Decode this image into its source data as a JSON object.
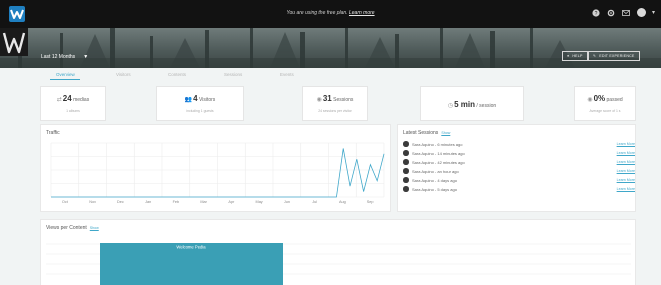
{
  "topbar": {
    "notice_text": "You are using the free plan.",
    "notice_link": "Learn more",
    "icons": [
      "help-icon",
      "settings-icon",
      "mail-icon",
      "user-avatar",
      "chevron-down-icon"
    ]
  },
  "hero": {
    "period": "Last 12 Months",
    "help_label": "HELP",
    "edit_label": "EDIT EXPERIENCE"
  },
  "tabs": [
    {
      "label": "Overview",
      "active": true
    },
    {
      "label": "Visitors"
    },
    {
      "label": "Contents"
    },
    {
      "label": "Sessions"
    },
    {
      "label": "Events"
    }
  ],
  "stats": [
    {
      "icon": "share-icon",
      "value": "24",
      "unit": "medias",
      "sub": "1 albums"
    },
    {
      "icon": "visitors-icon",
      "value": "4",
      "unit": "Visitors",
      "sub": "including 1 guests"
    },
    {
      "icon": "eye-icon",
      "value": "31",
      "unit": "Sessions",
      "sub": "24 sessions per visitor"
    },
    {
      "icon": "clock-icon",
      "value": "5 min",
      "unit": "/ session",
      "sub": ""
    },
    {
      "icon": "percent-icon",
      "value": "0%",
      "unit": "passed",
      "sub": "Average score of 1 s"
    }
  ],
  "traffic": {
    "title": "Traffic"
  },
  "chart_data": {
    "type": "line",
    "title": "Traffic",
    "categories": [
      "Oct",
      "Nov",
      "Dec",
      "Jan",
      "Feb",
      "Mar",
      "Apr",
      "May",
      "Jun",
      "Jul",
      "Aug",
      "Sep"
    ],
    "series": [
      {
        "values": [
          0,
          0,
          0,
          0,
          0,
          0,
          0,
          0,
          0,
          0,
          0,
          0,
          0,
          0,
          0,
          0,
          0,
          0,
          0,
          0,
          0,
          0,
          0,
          0,
          0,
          0,
          0,
          0,
          0,
          0,
          0,
          0,
          0,
          0,
          0,
          0,
          0,
          0,
          0,
          0,
          0,
          0,
          0,
          9,
          2,
          7,
          1,
          6,
          3,
          8
        ]
      }
    ],
    "ylim": [
      0,
      10
    ],
    "grid": true
  },
  "latest_sessions": {
    "title": "Latest Sessions",
    "link": "Show",
    "rows": [
      {
        "text": "Sara Aquino - 6 minutes ago",
        "action": "Learn More"
      },
      {
        "text": "Sara Aquino - 14 minutes ago",
        "action": "Learn More"
      },
      {
        "text": "Sara Aquino - 42 minutes ago",
        "action": "Learn More"
      },
      {
        "text": "Sara Aquino - an hour ago",
        "action": "Learn More"
      },
      {
        "text": "Sara Aquino - 4 days ago",
        "action": "Learn More"
      },
      {
        "text": "Sara Aquino - 5 days ago",
        "action": "Learn More"
      }
    ]
  },
  "views": {
    "title": "Views per Content",
    "link": "Show",
    "bar_label": "Welcome Pedia",
    "bar_color": "#3a9fb5"
  },
  "colors": {
    "accent": "#3fa7c9",
    "chart_line": "#3fa7c9"
  }
}
